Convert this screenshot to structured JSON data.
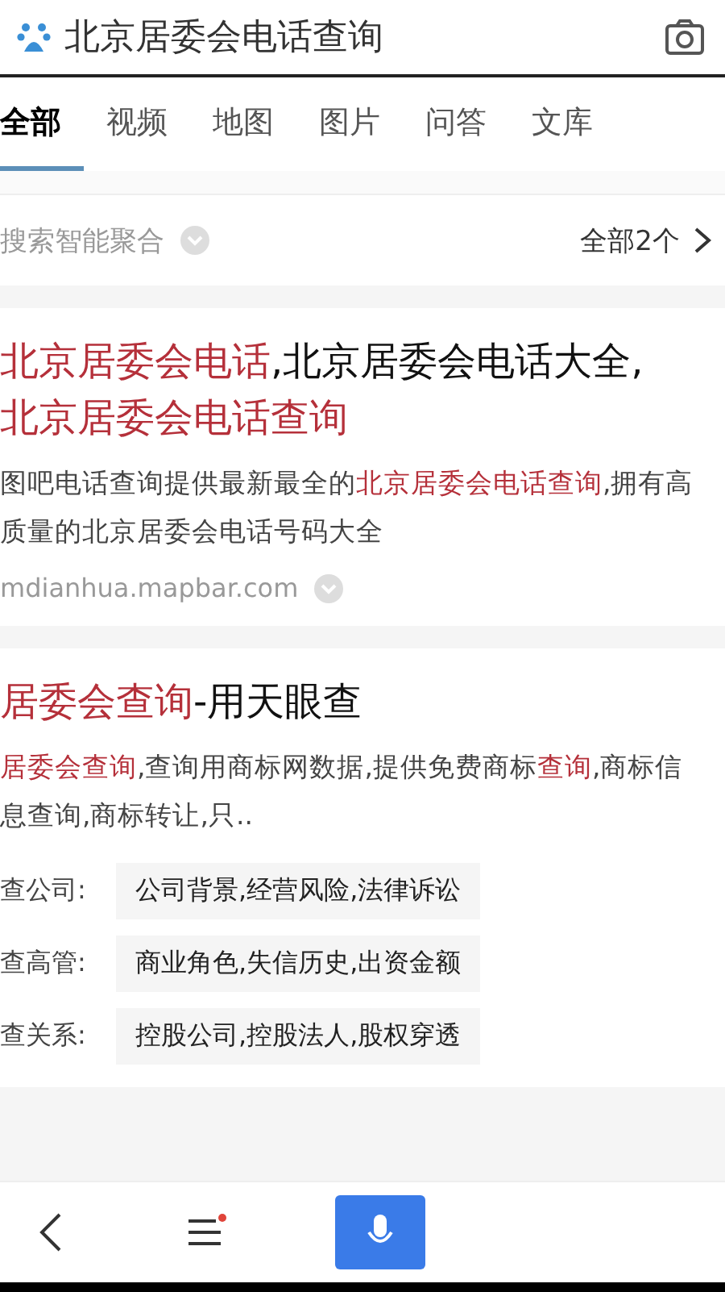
{
  "search": {
    "value": "北京居委会电话查询"
  },
  "tabs": [
    {
      "label": "全部",
      "selected": true
    },
    {
      "label": "视频",
      "selected": false
    },
    {
      "label": "地图",
      "selected": false
    },
    {
      "label": "图片",
      "selected": false
    },
    {
      "label": "问答",
      "selected": false
    },
    {
      "label": "文库",
      "selected": false
    }
  ],
  "aggregate": {
    "label": "搜索智能聚合",
    "more": "全部2个"
  },
  "results": [
    {
      "title": "**北京居委会电话**,北京居委会电话大全,**北京居委会电话查询**",
      "snippet": "图吧电话查询提供最新最全的**北京居委会电话查询**,拥有高质量的北京居委会电话号码大全",
      "source": "mdianhua.mapbar.com"
    },
    {
      "title": "**居委会查询**-用天眼查",
      "snippet": "**居委会查询**,查询用商标网数据,提供免费商标**查询**,商标信息查询,商标转让,只..",
      "facts": [
        {
          "label": "查公司:",
          "value": "公司背景,经营风险,法律诉讼"
        },
        {
          "label": "查高管:",
          "value": "商业角色,失信历史,出资金额"
        },
        {
          "label": "查关系:",
          "value": "控股公司,控股法人,股权穿透"
        }
      ]
    }
  ]
}
